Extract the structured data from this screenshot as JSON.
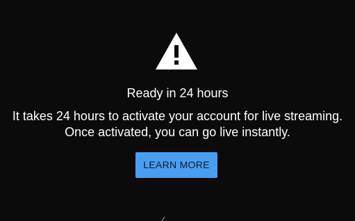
{
  "dialog": {
    "icon": "warning-icon",
    "title": "Ready in 24 hours",
    "message": "It takes 24 hours to activate your account for live streaming. Once activated, you can go live instantly.",
    "button_label": "LEARN MORE"
  },
  "colors": {
    "background": "#0b0b0b",
    "text": "#ffffff",
    "button": "#4a9ef2",
    "button_text": "#0c1a2a"
  }
}
